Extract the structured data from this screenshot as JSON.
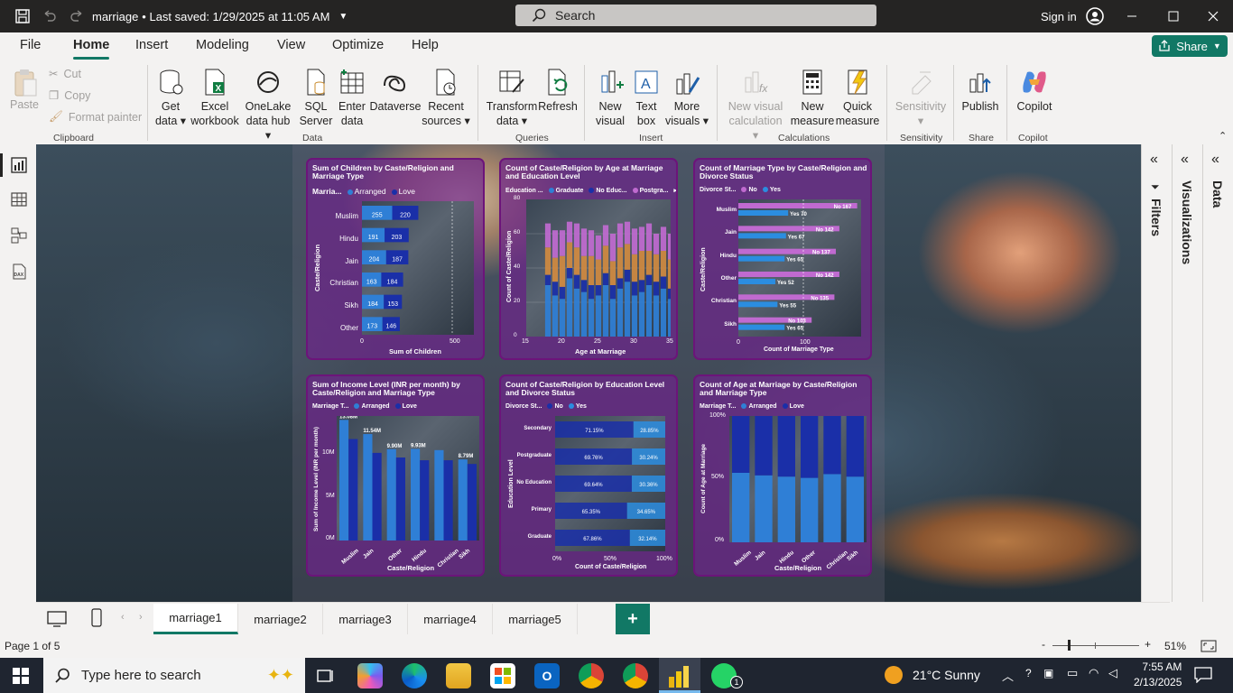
{
  "app": {
    "file_name": "marriage",
    "save_status": "• Last saved: 1/29/2025 at 11:05 AM",
    "search_placeholder": "Search",
    "sign_in": "Sign in"
  },
  "menu": {
    "tabs": [
      "File",
      "Home",
      "Insert",
      "Modeling",
      "View",
      "Optimize",
      "Help"
    ],
    "active": "Home",
    "share_label": "Share"
  },
  "ribbon": {
    "clipboard": {
      "paste": "Paste",
      "cut": "Cut",
      "copy": "Copy",
      "format_painter": "Format painter",
      "label": "Clipboard"
    },
    "data": {
      "items": [
        {
          "l1": "Get",
          "l2": "data ▾",
          "icon": "database-icon"
        },
        {
          "l1": "Excel",
          "l2": "workbook",
          "icon": "excel-icon"
        },
        {
          "l1": "OneLake",
          "l2": "data hub ▾",
          "icon": "onelake-icon"
        },
        {
          "l1": "SQL",
          "l2": "Server",
          "icon": "sql-server-icon"
        },
        {
          "l1": "Enter",
          "l2": "data",
          "icon": "table-icon"
        },
        {
          "l1": "Dataverse",
          "l2": "",
          "icon": "dataverse-icon"
        },
        {
          "l1": "Recent",
          "l2": "sources ▾",
          "icon": "recent-sources-icon"
        }
      ],
      "label": "Data"
    },
    "queries": {
      "items": [
        {
          "l1": "Transform",
          "l2": "data ▾"
        },
        {
          "l1": "Refresh",
          "l2": ""
        }
      ],
      "label": "Queries"
    },
    "insert": {
      "items": [
        {
          "l1": "New",
          "l2": "visual"
        },
        {
          "l1": "Text",
          "l2": "box"
        },
        {
          "l1": "More",
          "l2": "visuals ▾"
        }
      ],
      "label": "Insert"
    },
    "calculations": {
      "items": [
        {
          "l1": "New visual",
          "l2": "calculation ▾"
        },
        {
          "l1": "New",
          "l2": "measure"
        },
        {
          "l1": "Quick",
          "l2": "measure"
        }
      ],
      "label": "Calculations"
    },
    "sensitivity": {
      "l1": "Sensitivity",
      "l2": "▾",
      "label": "Sensitivity"
    },
    "share": {
      "l1": "Publish",
      "label": "Share"
    },
    "copilot": {
      "l1": "Copilot",
      "label": "Copilot"
    }
  },
  "colors": {
    "arranged": "#2f7fd6",
    "love": "#1a2fa8",
    "no": "#c06ad0",
    "yes": "#2b8de0",
    "graduate": "#2f7fd6",
    "no_education": "#1a2fa8",
    "postgraduate": "#c06ad0",
    "secondary": "#d08a40",
    "accent": "#117865",
    "visual_border": "#6c147a"
  },
  "visuals": {
    "v1": {
      "title": "Sum of Children by Caste/Religion and Marriage Type",
      "legend_title": "Marria...",
      "legend": [
        "Arranged",
        "Love"
      ],
      "y_axis_title": "Caste/Religion",
      "x_axis_title": "Sum of Children",
      "x_ticks": [
        "0",
        "500"
      ]
    },
    "v2": {
      "title": "Count of Caste/Religion by Age at Marriage and Education Level",
      "legend_title": "Education ...",
      "legend": [
        "Graduate",
        "No Educ...",
        "Postgra..."
      ],
      "y_axis_title": "Count of Caste/Religion",
      "x_axis_title": "Age at Marriage",
      "x_ticks": [
        "15",
        "20",
        "25",
        "30",
        "35"
      ],
      "y_ticks": [
        "0",
        "20",
        "40",
        "60",
        "80"
      ]
    },
    "v3": {
      "title": "Count of Marriage Type by Caste/Religion and Divorce Status",
      "legend_title": "Divorce St...",
      "legend": [
        "No",
        "Yes"
      ],
      "y_axis_title": "Caste/Religion",
      "x_axis_title": "Count of Marriage Type",
      "x_ticks": [
        "0",
        "100"
      ]
    },
    "v4": {
      "title": "Sum of Income Level (INR per month) by Caste/Religion and Marriage Type",
      "legend_title": "Marriage T...",
      "legend": [
        "Arranged",
        "Love"
      ],
      "y_axis_title": "Sum of Income Level (INR per month)",
      "x_axis_title": "Caste/Religion",
      "y_ticks": [
        "0M",
        "5M",
        "10M"
      ]
    },
    "v5": {
      "title": "Count of Caste/Religion by Education Level and Divorce Status",
      "legend_title": "Divorce St...",
      "legend": [
        "No",
        "Yes"
      ],
      "y_axis_title": "Education Level",
      "x_axis_title": "Count of Caste/Religion",
      "x_ticks": [
        "0%",
        "50%",
        "100%"
      ]
    },
    "v6": {
      "title": "Count of Age at Marriage by Caste/Religion and Marriage Type",
      "legend_title": "Marriage T...",
      "legend": [
        "Arranged",
        "Love"
      ],
      "y_axis_title": "Count of Age at Marriage",
      "x_axis_title": "Caste/Religion",
      "y_ticks": [
        "0%",
        "50%",
        "100%"
      ]
    }
  },
  "chart_data": [
    {
      "type": "bar",
      "orientation": "horizontal",
      "stacked": true,
      "title": "Sum of Children by Caste/Religion and Marriage Type",
      "categories": [
        "Muslim",
        "Hindu",
        "Jain",
        "Christian",
        "Sikh",
        "Other"
      ],
      "series": [
        {
          "name": "Arranged",
          "values": [
            255,
            191,
            204,
            163,
            184,
            173
          ]
        },
        {
          "name": "Love",
          "values": [
            220,
            203,
            187,
            184,
            153,
            146
          ]
        }
      ],
      "xlabel": "Sum of Children",
      "ylabel": "Caste/Religion",
      "xlim": [
        0,
        500
      ]
    },
    {
      "type": "bar",
      "stacked": true,
      "title": "Count of Caste/Religion by Age at Marriage and Education Level",
      "x": [
        18,
        19,
        20,
        21,
        22,
        23,
        24,
        25,
        26,
        27,
        28,
        29,
        30,
        31,
        32,
        33,
        34,
        35
      ],
      "series": [
        {
          "name": "Graduate",
          "values": [
            30,
            24,
            22,
            34,
            28,
            26,
            22,
            24,
            30,
            22,
            28,
            32,
            24,
            26,
            30,
            24,
            28,
            22
          ]
        },
        {
          "name": "No Educ...",
          "values": [
            6,
            8,
            7,
            6,
            8,
            7,
            8,
            6,
            7,
            8,
            6,
            7,
            8,
            7,
            6,
            8,
            7,
            6
          ]
        },
        {
          "name": "Postgra...",
          "values": [
            14,
            16,
            15,
            12,
            14,
            16,
            15,
            14,
            12,
            16,
            14,
            13,
            15,
            14,
            16,
            12,
            14,
            15
          ]
        },
        {
          "name": "Secondary",
          "values": [
            16,
            14,
            18,
            15,
            16,
            14,
            17,
            15,
            16,
            14,
            18,
            15,
            16,
            17,
            14,
            16,
            15,
            17
          ]
        }
      ],
      "xlabel": "Age at Marriage",
      "ylabel": "Count of Caste/Religion",
      "ylim": [
        0,
        80
      ],
      "xlim": [
        15,
        35
      ]
    },
    {
      "type": "bar",
      "orientation": "horizontal",
      "title": "Count of Marriage Type by Caste/Religion and Divorce Status",
      "categories": [
        "Muslim",
        "Jain",
        "Hindu",
        "Other",
        "Christian",
        "Sikh"
      ],
      "series": [
        {
          "name": "No",
          "values": [
            167,
            142,
            137,
            142,
            135,
            103
          ]
        },
        {
          "name": "Yes",
          "values": [
            70,
            67,
            65,
            52,
            55,
            65
          ]
        }
      ],
      "data_labels": {
        "No": [
          "No 167",
          "No 142",
          "No 137",
          "No 142",
          "No 135",
          "No 103"
        ],
        "Yes": [
          "Yes 70",
          "Yes 67",
          "Yes 65",
          "Yes 52",
          "Yes 55",
          "Yes 65"
        ]
      },
      "xlabel": "Count of Marriage Type",
      "ylabel": "Caste/Religion",
      "xlim": [
        0,
        170
      ]
    },
    {
      "type": "bar",
      "title": "Sum of Income Level (INR per month) by Caste/Religion and Marriage Type",
      "categories": [
        "Muslim",
        "Jain",
        "Other",
        "Hindu",
        "Christian",
        "Sikh"
      ],
      "series": [
        {
          "name": "Arranged",
          "values": [
            13.08,
            11.54,
            9.9,
            9.93,
            9.8,
            8.79
          ]
        },
        {
          "name": "Love",
          "values": [
            11.0,
            9.5,
            9.0,
            8.7,
            8.7,
            8.3
          ]
        }
      ],
      "data_labels": [
        "13.08M",
        "11.54M",
        "9.90M",
        "9.93M",
        "8.79M"
      ],
      "units": "M",
      "xlabel": "Caste/Religion",
      "ylabel": "Sum of Income Level (INR per month)",
      "ylim": [
        0,
        13.5
      ]
    },
    {
      "type": "bar",
      "orientation": "horizontal",
      "stacked": "100%",
      "title": "Count of Caste/Religion by Education Level and Divorce Status",
      "categories": [
        "Secondary",
        "Postgraduate",
        "No Education",
        "Primary",
        "Graduate"
      ],
      "series": [
        {
          "name": "No",
          "values": [
            71.15,
            69.76,
            69.64,
            65.35,
            67.86
          ]
        },
        {
          "name": "Yes",
          "values": [
            28.85,
            30.24,
            30.36,
            34.65,
            32.14
          ]
        }
      ],
      "data_labels": {
        "No": [
          "71.15%",
          "69.76%",
          "69.64%",
          "65.35%",
          "67.86%"
        ],
        "Yes": [
          "28.85%",
          "30.24%",
          "30.36%",
          "34.65%",
          "32.14%"
        ]
      },
      "xlabel": "Count of Caste/Religion",
      "ylabel": "Education Level",
      "xlim": [
        0,
        100
      ]
    },
    {
      "type": "bar",
      "stacked": "100%",
      "title": "Count of Age at Marriage by Caste/Religion and Marriage Type",
      "categories": [
        "Muslim",
        "Jain",
        "Hindu",
        "Other",
        "Christian",
        "Sikh"
      ],
      "series": [
        {
          "name": "Arranged",
          "values": [
            55,
            53,
            52,
            51,
            54,
            52
          ]
        },
        {
          "name": "Love",
          "values": [
            45,
            47,
            48,
            49,
            46,
            48
          ]
        }
      ],
      "xlabel": "Caste/Religion",
      "ylabel": "Count of Age at Marriage",
      "ylim": [
        0,
        100
      ]
    }
  ],
  "pages": {
    "tabs": [
      "marriage1",
      "marriage2",
      "marriage3",
      "marriage4",
      "marriage5"
    ],
    "active": "marriage1",
    "add": "+"
  },
  "panes": {
    "filters": "Filters",
    "visualizations": "Visualizations",
    "data": "Data"
  },
  "status": {
    "page": "Page 1 of 5",
    "zoom": "51%",
    "zoom_minus": "-",
    "zoom_plus": "+"
  },
  "taskbar": {
    "search_placeholder": "Type here to search",
    "weather": "21°C  Sunny",
    "time": "7:55 AM",
    "date": "2/13/2025",
    "whatsapp_badge": "1"
  }
}
